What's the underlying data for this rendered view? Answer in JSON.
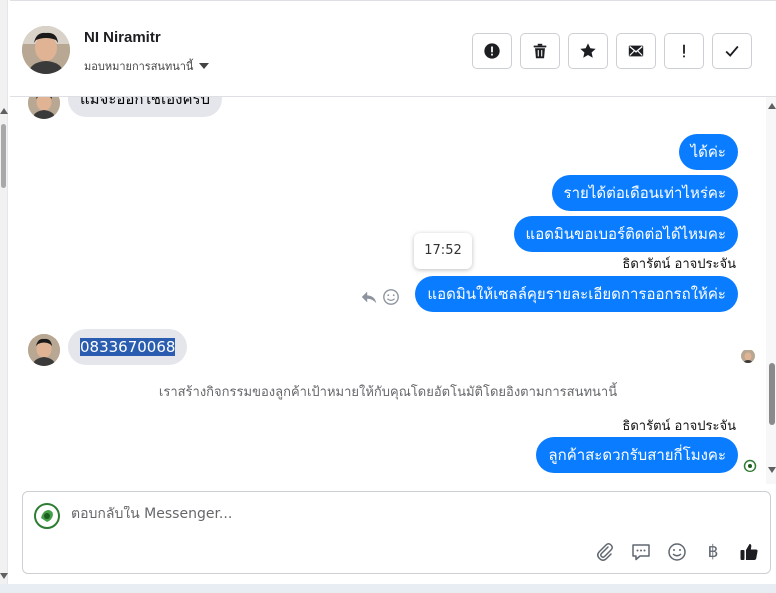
{
  "header": {
    "contact_name": "NI Niramitr",
    "assign_label": "มอบหมายการสนทนานี้"
  },
  "chat": {
    "incoming_partial": "แม่จะออกใช้เองครับ",
    "outgoing_1": "ได้ค่ะ",
    "outgoing_2": "รายได้ต่อเดือนเท่าไหร่คะ",
    "outgoing_3": "แอดมินขอเบอร์ติดต่อได้ไหมคะ",
    "sender_name_1": "ธิดารัตน์ อาจประจัน",
    "tooltip_time": "17:52",
    "outgoing_4": "แอดมินให้เซลล์คุยรายละเอียดการออกรถให้ค่ะ",
    "incoming_phone": "0833670068",
    "system_message": "เราสร้างกิจกรรมของลูกค้าเป้าหมายให้กับคุณโดยอัตโนมัติโดยอิงตามการสนทนานี้",
    "sender_name_2": "ธิดารัตน์ อาจประจัน",
    "outgoing_5": "ลูกค้าสะดวกรับสายกี่โมงคะ"
  },
  "composer": {
    "placeholder": "ตอบกลับใน Messenger..."
  },
  "colors": {
    "accent": "#0a7cff",
    "incoming_bubble": "#e4e6eb",
    "selection": "#2a5db0"
  },
  "icons": {
    "header_actions": [
      "alert-circle-icon",
      "trash-icon",
      "star-icon",
      "envelope-icon",
      "exclamation-icon",
      "check-icon"
    ],
    "composer_tools": [
      "paperclip-icon",
      "saved-reply-icon",
      "emoji-icon",
      "baht-icon",
      "thumbs-up-icon"
    ]
  }
}
